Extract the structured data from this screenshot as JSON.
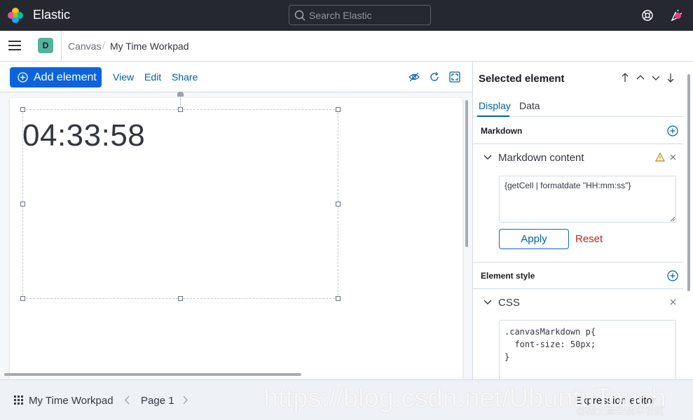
{
  "header": {
    "brand": "Elastic",
    "search_placeholder": "Search Elastic"
  },
  "breadcrumb": {
    "space_initial": "D",
    "items": [
      "Canvas",
      "My Time Workpad"
    ],
    "separator": "/"
  },
  "toolbar": {
    "add_element_label": "Add element",
    "view_label": "View",
    "edit_label": "Edit",
    "share_label": "Share"
  },
  "workpad": {
    "clock_text": "04:33:58"
  },
  "sidebar": {
    "title": "Selected element",
    "tabs": [
      {
        "label": "Display",
        "active": true
      },
      {
        "label": "Data",
        "active": false
      }
    ],
    "markdown_section": {
      "label": "Markdown",
      "content_label": "Markdown content",
      "content_value": "{getCell | formatdate \"HH:mm:ss\"}",
      "apply_label": "Apply",
      "reset_label": "Reset"
    },
    "element_style_section": {
      "label": "Element style",
      "css_label": "CSS",
      "css_value": ".canvasMarkdown p{\n  font-size: 50px;\n}"
    }
  },
  "footer": {
    "workpad_title": "My Time Workpad",
    "page_label": "Page 1",
    "expression_editor_label": "Expression editor"
  },
  "watermark": {
    "url_text": "https://blog.csdn.net/UbuntuTouch",
    "cn_text": "@稀土掘金技术社区"
  },
  "colors": {
    "header_bg": "#25282f",
    "primary": "#0b64dd",
    "link": "#0061a6",
    "danger": "#bd271e",
    "space_badge": "#54b399",
    "notification": "#e7417a"
  }
}
